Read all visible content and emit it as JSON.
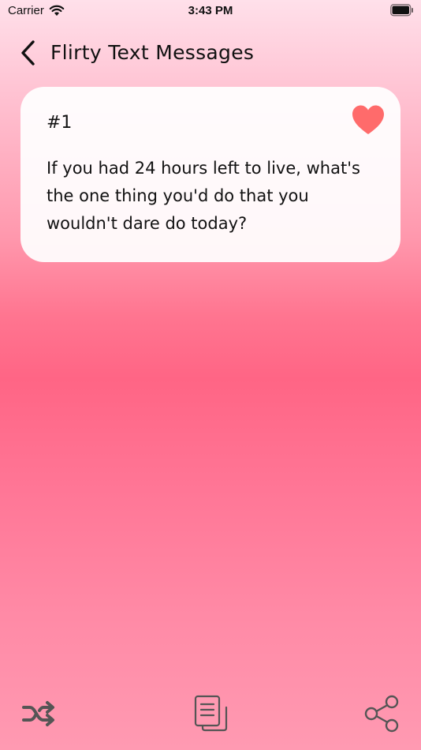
{
  "status_bar": {
    "carrier": "Carrier",
    "time": "3:43 PM"
  },
  "nav": {
    "title": "Flirty Text Messages",
    "back_icon": "chevron-left-icon"
  },
  "card": {
    "number": "#1",
    "text": "If you had 24 hours left to live, what's the one thing you'd do that you wouldn't dare do today?",
    "heart_icon": "heart-icon",
    "heart_color": "#ff6b6b"
  },
  "toolbar": {
    "shuffle_icon": "shuffle-icon",
    "copy_icon": "copy-icon",
    "share_icon": "share-icon",
    "icon_color": "#555555"
  }
}
